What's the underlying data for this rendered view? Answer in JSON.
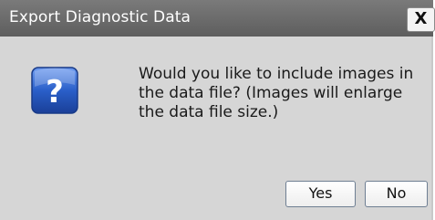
{
  "dialog": {
    "title": "Export Diagnostic Data",
    "close_label": "X",
    "icon": "question-icon",
    "message_lines": [
      "Would you like to include images in",
      "the data file? (Images will enlarge",
      "the data file size.)"
    ],
    "buttons": {
      "yes": "Yes",
      "no": "No"
    }
  },
  "colors": {
    "titlebar": "#6b6b6b",
    "dialog_bg": "#d6d6d6",
    "icon_blue": "#2a5fc9"
  }
}
